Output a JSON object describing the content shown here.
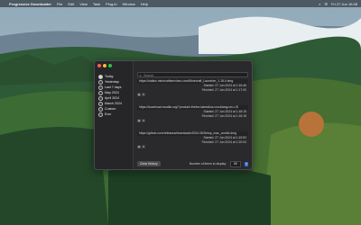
{
  "menubar": {
    "app_name": "Progressive Downloader",
    "menus": [
      "File",
      "Edit",
      "View",
      "Task",
      "Plug-in",
      "Window",
      "Help"
    ],
    "clock": "Fri 27 Jun 16:38"
  },
  "sidebar": {
    "items": [
      {
        "label": "Today",
        "selected": true
      },
      {
        "label": "Yesterday",
        "selected": false
      },
      {
        "label": "Last 7 days",
        "selected": false
      },
      {
        "label": "May 2024",
        "selected": false
      },
      {
        "label": "April 2024",
        "selected": false
      },
      {
        "label": "March 2024",
        "selected": false
      },
      {
        "label": "Custom",
        "selected": false
      },
      {
        "label": "Ever",
        "selected": false
      }
    ]
  },
  "search": {
    "placeholder": "Search"
  },
  "entries": [
    {
      "url": "https://statics.minecraftservices.com/Minecraft_Launcher_1.18.4.dmg",
      "started": "Started: 27 Jun 2024 at 1:16:46",
      "finished": "Finished: 27 Jun 2024 at 1:17:00",
      "progress": 1.0
    },
    {
      "url": "https://download.mozilla.org/?product=firefox-latest&os=osx&lang=en-US",
      "started": "Started: 27 Jun 2024 at 1:18:15",
      "finished": "Finished: 27 Jun 2024 at 1:18:15",
      "progress": 1.0
    },
    {
      "url": "https://github.com/releases/download/v2024.06/Setup_mac_arm64.dmg",
      "started": "Started: 27 Jun 2024 at 1:19:52",
      "finished": "Finished: 27 Jun 2024 at 1:20:04",
      "progress": 1.0
    }
  ],
  "footer": {
    "clear_label": "Clear History",
    "items_label": "Number of items to display:",
    "items_value": "50"
  },
  "colors": {
    "traffic_red": "#ff5f57",
    "traffic_yellow": "#febc2e",
    "traffic_green": "#28c840",
    "accent": "#3b6fd6"
  }
}
